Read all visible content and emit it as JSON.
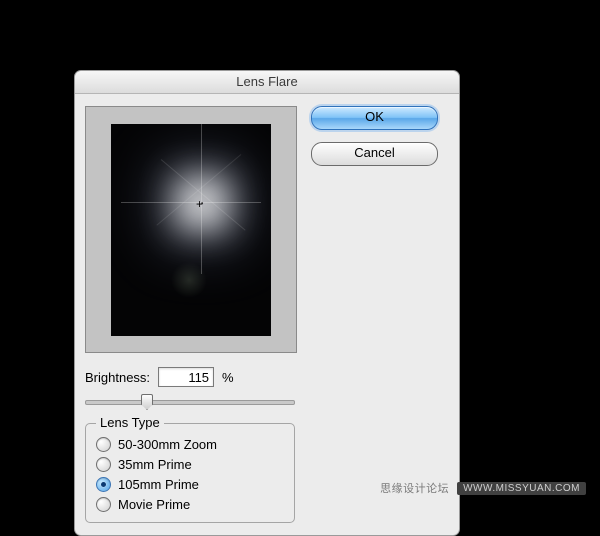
{
  "dialog": {
    "title": "Lens Flare",
    "brightness_label": "Brightness:",
    "brightness_value": "115",
    "brightness_suffix": "%",
    "lens_group_title": "Lens Type",
    "lens_options": [
      {
        "label": "50-300mm Zoom",
        "selected": false
      },
      {
        "label": "35mm Prime",
        "selected": false
      },
      {
        "label": "105mm Prime",
        "selected": true
      },
      {
        "label": "Movie Prime",
        "selected": false
      }
    ],
    "ok_label": "OK",
    "cancel_label": "Cancel"
  },
  "watermark": {
    "text": "思缘设计论坛",
    "url": "WWW.MISSYUAN.COM"
  }
}
